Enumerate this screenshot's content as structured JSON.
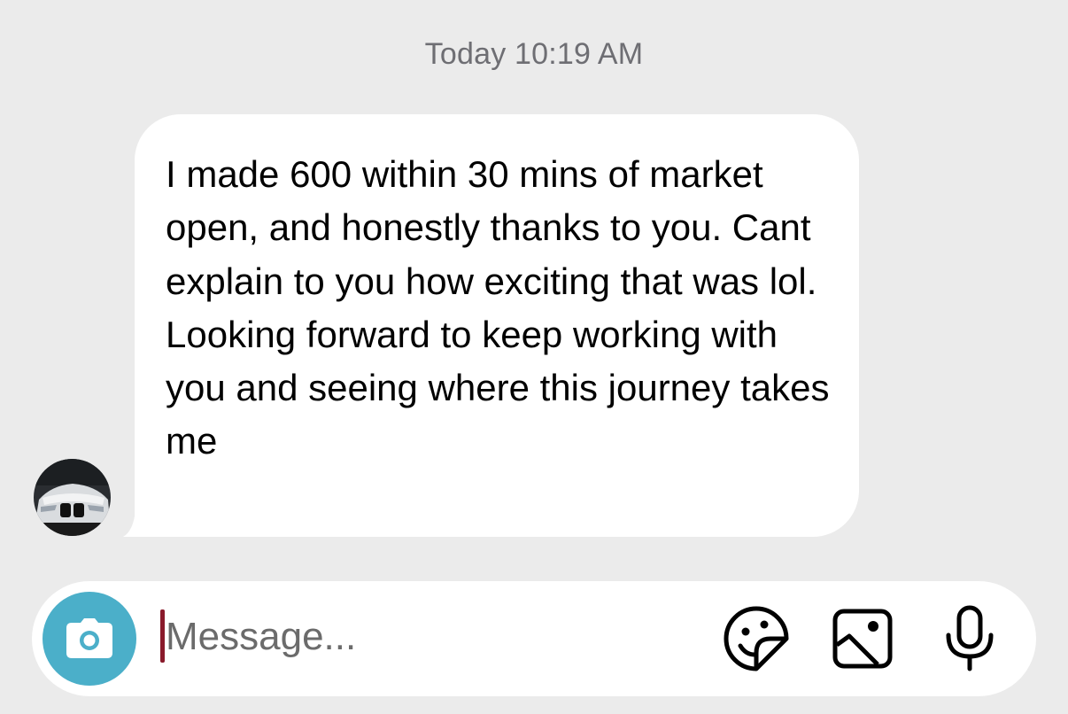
{
  "chat": {
    "timestamp": "Today 10:19 AM",
    "messages": [
      {
        "sender": "other",
        "text": "I made 600 within 30 mins of market open, and honestly thanks to you. Cant explain to you how exciting that was lol. Looking forward to keep working with you and seeing where this journey takes me"
      }
    ]
  },
  "composer": {
    "placeholder": "Message...",
    "value": ""
  },
  "icons": {
    "camera": "camera-icon",
    "sticker": "sticker-icon",
    "gallery": "gallery-icon",
    "microphone": "microphone-icon",
    "avatar": "avatar-photo"
  },
  "colors": {
    "background": "#ebebeb",
    "bubble": "#ffffff",
    "camera_button": "#4bafc9",
    "timestamp_text": "#6e6e73",
    "caret": "#8a1a2b"
  }
}
